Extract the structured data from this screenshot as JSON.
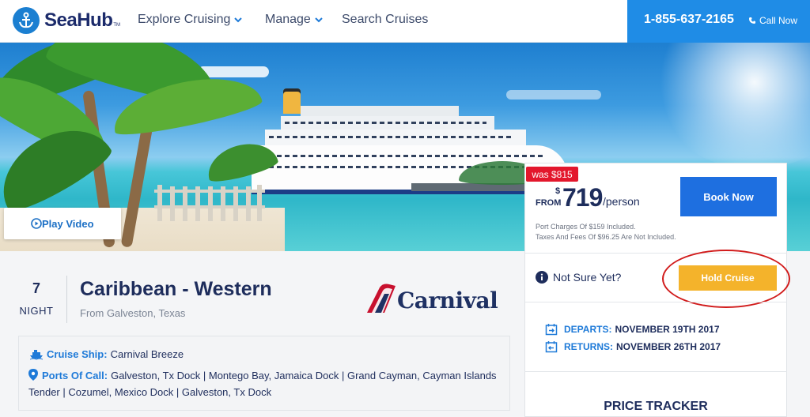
{
  "nav": {
    "brand": "SeaHub",
    "brand_tm": "TM",
    "items": [
      {
        "label": "Explore Cruising",
        "has_dropdown": true
      },
      {
        "label": "Manage",
        "has_dropdown": true
      },
      {
        "label": "Search Cruises",
        "has_dropdown": false
      }
    ],
    "phone": "1-855-637-2165",
    "call_now": "Call Now"
  },
  "hero": {
    "play_video": "Play Video"
  },
  "pricing": {
    "was_price": "was $815",
    "from_label": "FROM",
    "currency": "$",
    "price": "719",
    "per": "/person",
    "port_charges_note": "Port Charges Of $159 Included.",
    "taxes_note": "Taxes And Fees Of $96.25 Are Not Included.",
    "book_now": "Book Now",
    "not_sure": "Not Sure Yet?",
    "hold_cruise": "Hold Cruise",
    "departs_label": "DEPARTS:",
    "departs_date": "NOVEMBER 19TH 2017",
    "returns_label": "RETURNS:",
    "returns_date": "NOVEMBER 26TH 2017",
    "price_tracker": "PRICE TRACKER"
  },
  "cruise": {
    "nights": "7",
    "nights_label": "NIGHT",
    "title": "Caribbean - Western",
    "from_port": "From Galveston, Texas",
    "line_brand": "Carnival",
    "ship_label": "Cruise Ship:",
    "ship_name": "Carnival Breeze",
    "ports_label": "Ports Of Call:",
    "ports": "Galveston, Tx Dock | Montego Bay, Jamaica Dock | Grand Cayman, Cayman Islands Tender | Cozumel, Mexico Dock | Galveston, Tx Dock"
  },
  "colors": {
    "brand_navy": "#1e2d5c",
    "accent_blue": "#1e7ad8",
    "phone_bar": "#1f8ce6",
    "book_now": "#1e6fe0",
    "hold_cruise": "#f4b32b",
    "was_badge": "#e3172c",
    "annotation_circle": "#d11b1b"
  }
}
